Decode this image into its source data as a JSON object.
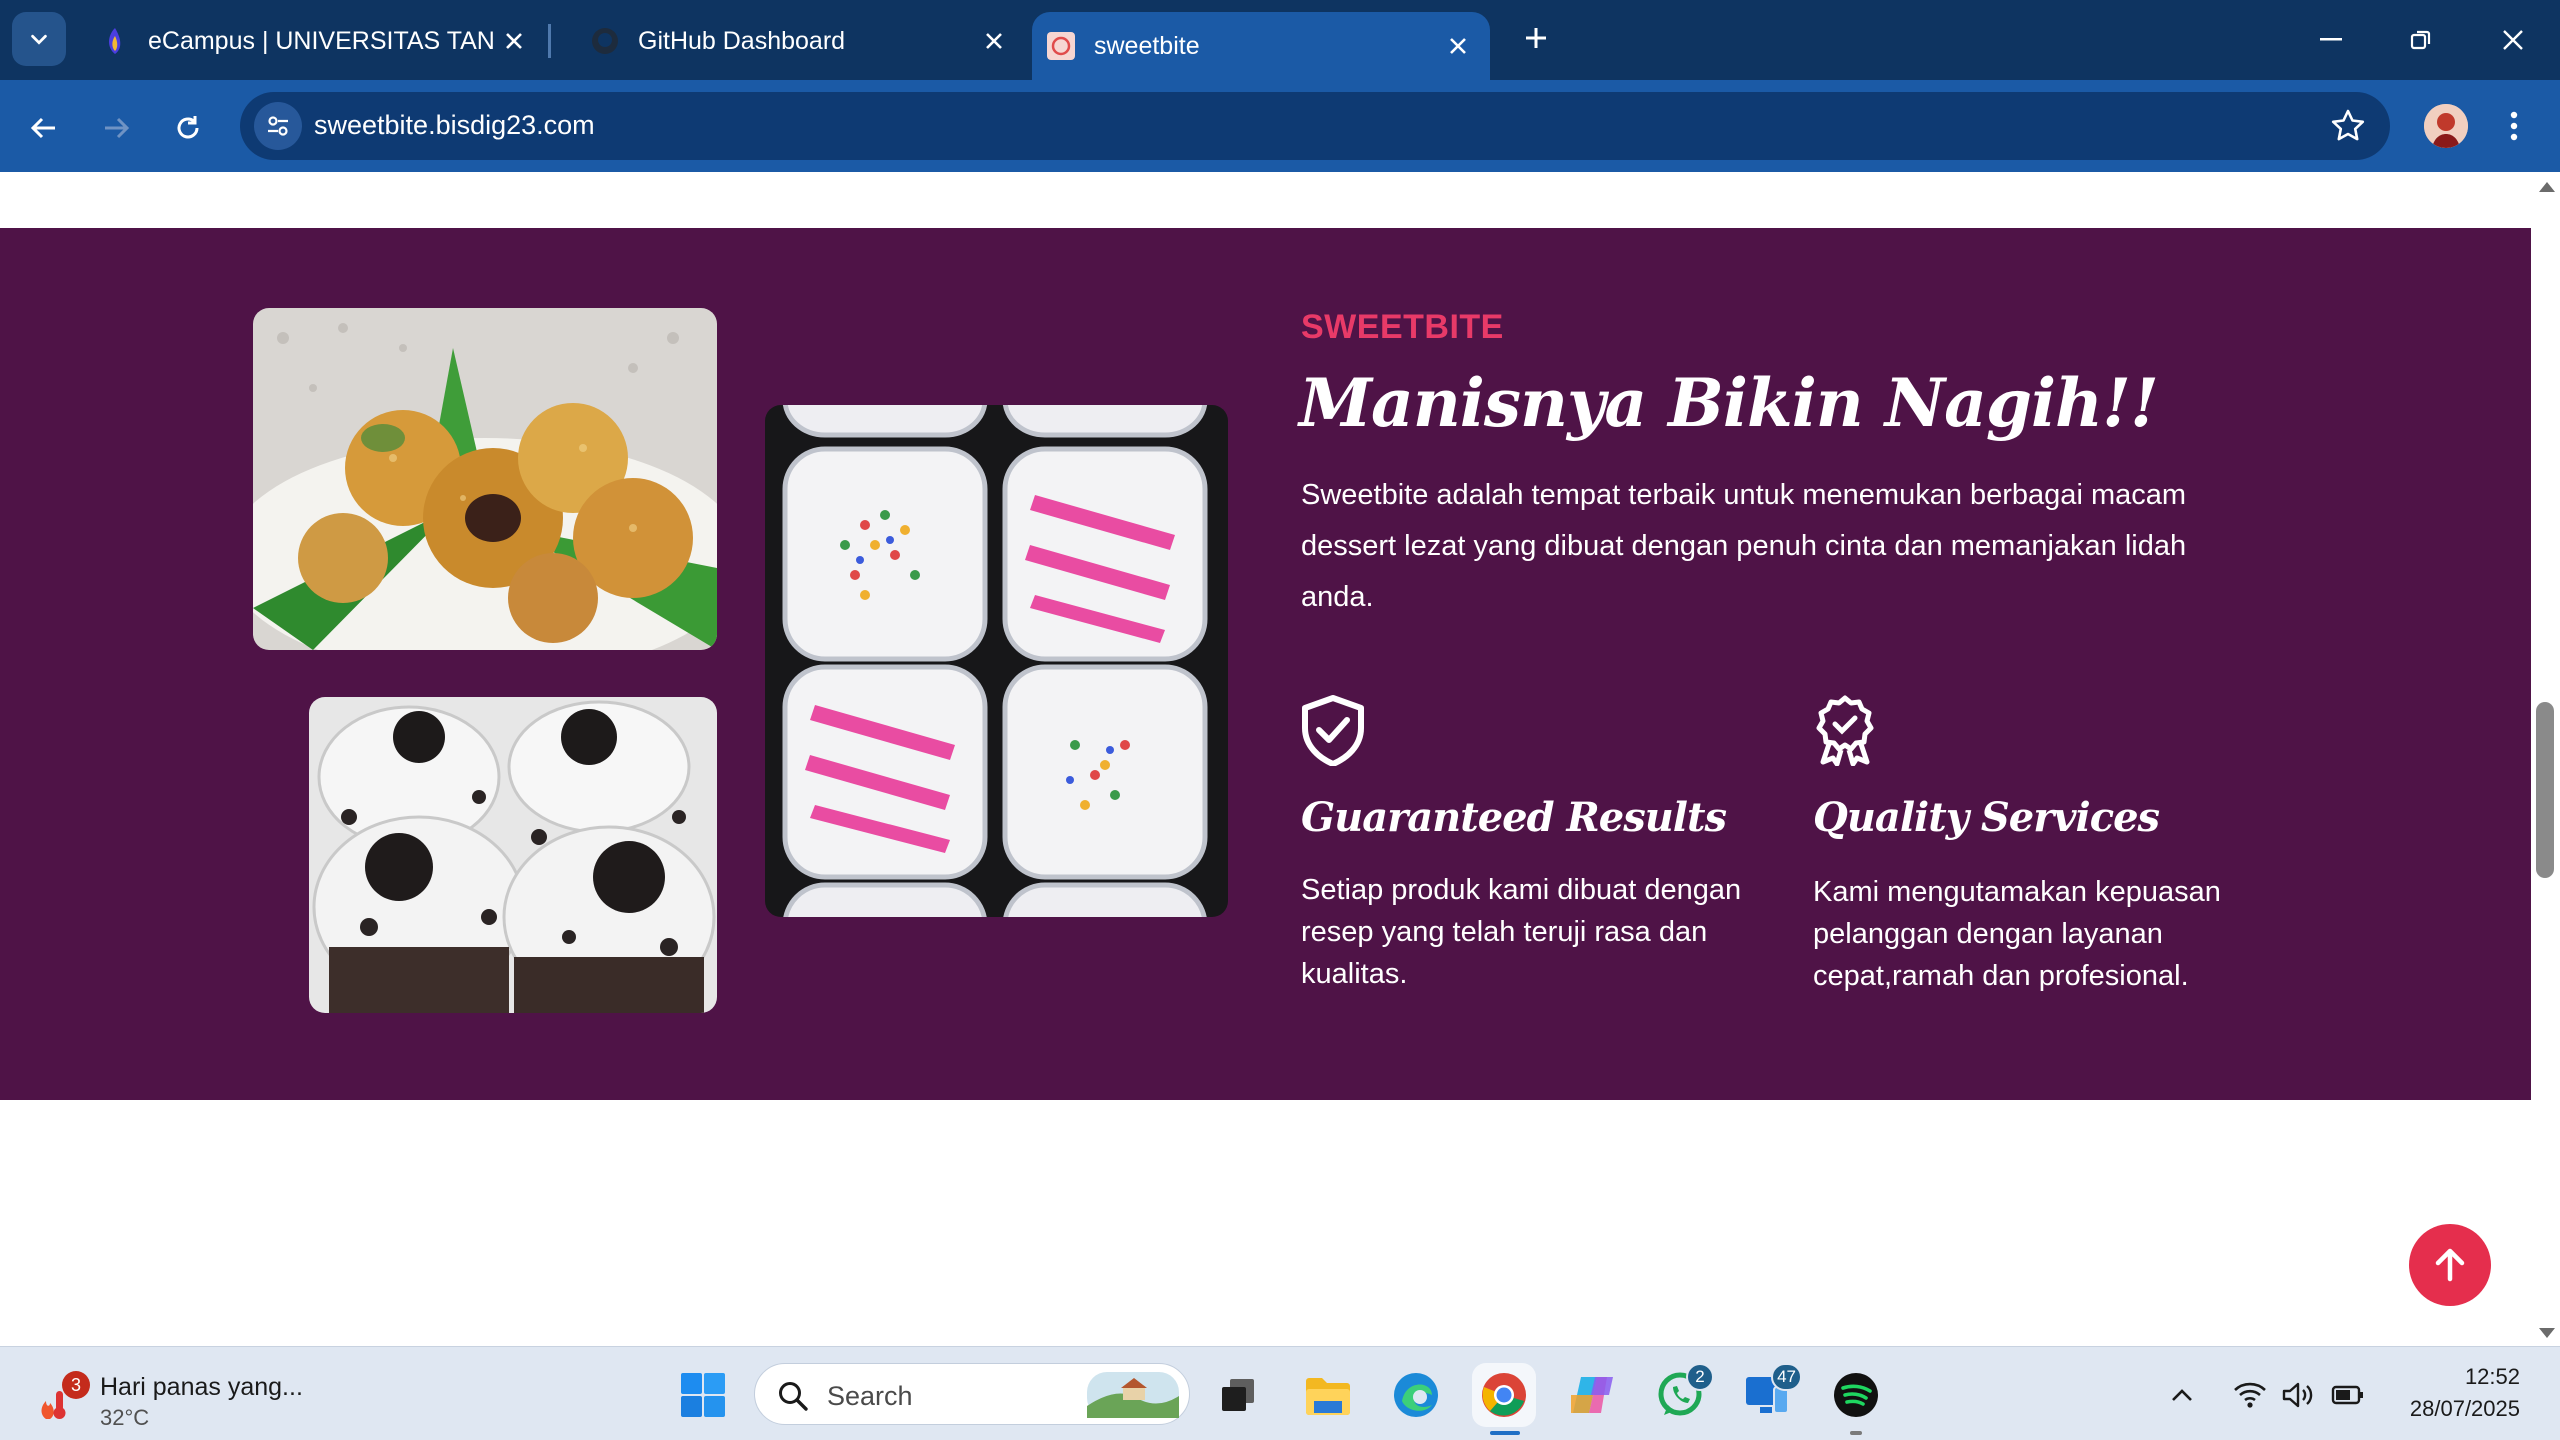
{
  "browser": {
    "tabs": [
      {
        "title": "eCampus | UNIVERSITAS TANGERANG",
        "favicon": "ecampus-logo"
      },
      {
        "title": "GitHub Dashboard",
        "favicon": "github-icon"
      },
      {
        "title": "sweetbite",
        "favicon": "sweetbite-favicon",
        "active": true
      }
    ],
    "url": "sweetbite.bisdig23.com"
  },
  "page": {
    "colors": {
      "section_bg": "#4f1347",
      "accent": "#e83a68",
      "back_to_top": "#e52e4d"
    },
    "about": {
      "kicker": "SWEETBITE",
      "headline": "Manisnya Bikin Nagih!!",
      "description": "Sweetbite adalah tempat terbaik untuk menemukan berbagai macam dessert lezat yang dibuat dengan penuh cinta dan memanjakan lidah anda.",
      "features": [
        {
          "icon": "shield-check-icon",
          "title": "Guaranteed Results",
          "text": "Setiap produk kami dibuat dengan resep yang telah teruji rasa dan kualitas."
        },
        {
          "icon": "award-badge-icon",
          "title": "Quality Services",
          "text": "Kami mengutamakan kepuasan pelanggan dengan layanan cepat,ramah dan profesional."
        }
      ],
      "images": [
        "fried-dessert-balls-photo",
        "oreo-cream-cups-photo",
        "sprinkle-dessert-boxes-photo"
      ]
    }
  },
  "taskbar": {
    "weather": {
      "badge": "3",
      "text": "Hari panas yang...",
      "temp": "32°C"
    },
    "search_placeholder": "Search",
    "badges": {
      "whatsapp": "2",
      "phone_link": "47"
    },
    "time": "12:52",
    "date": "28/07/2025"
  }
}
